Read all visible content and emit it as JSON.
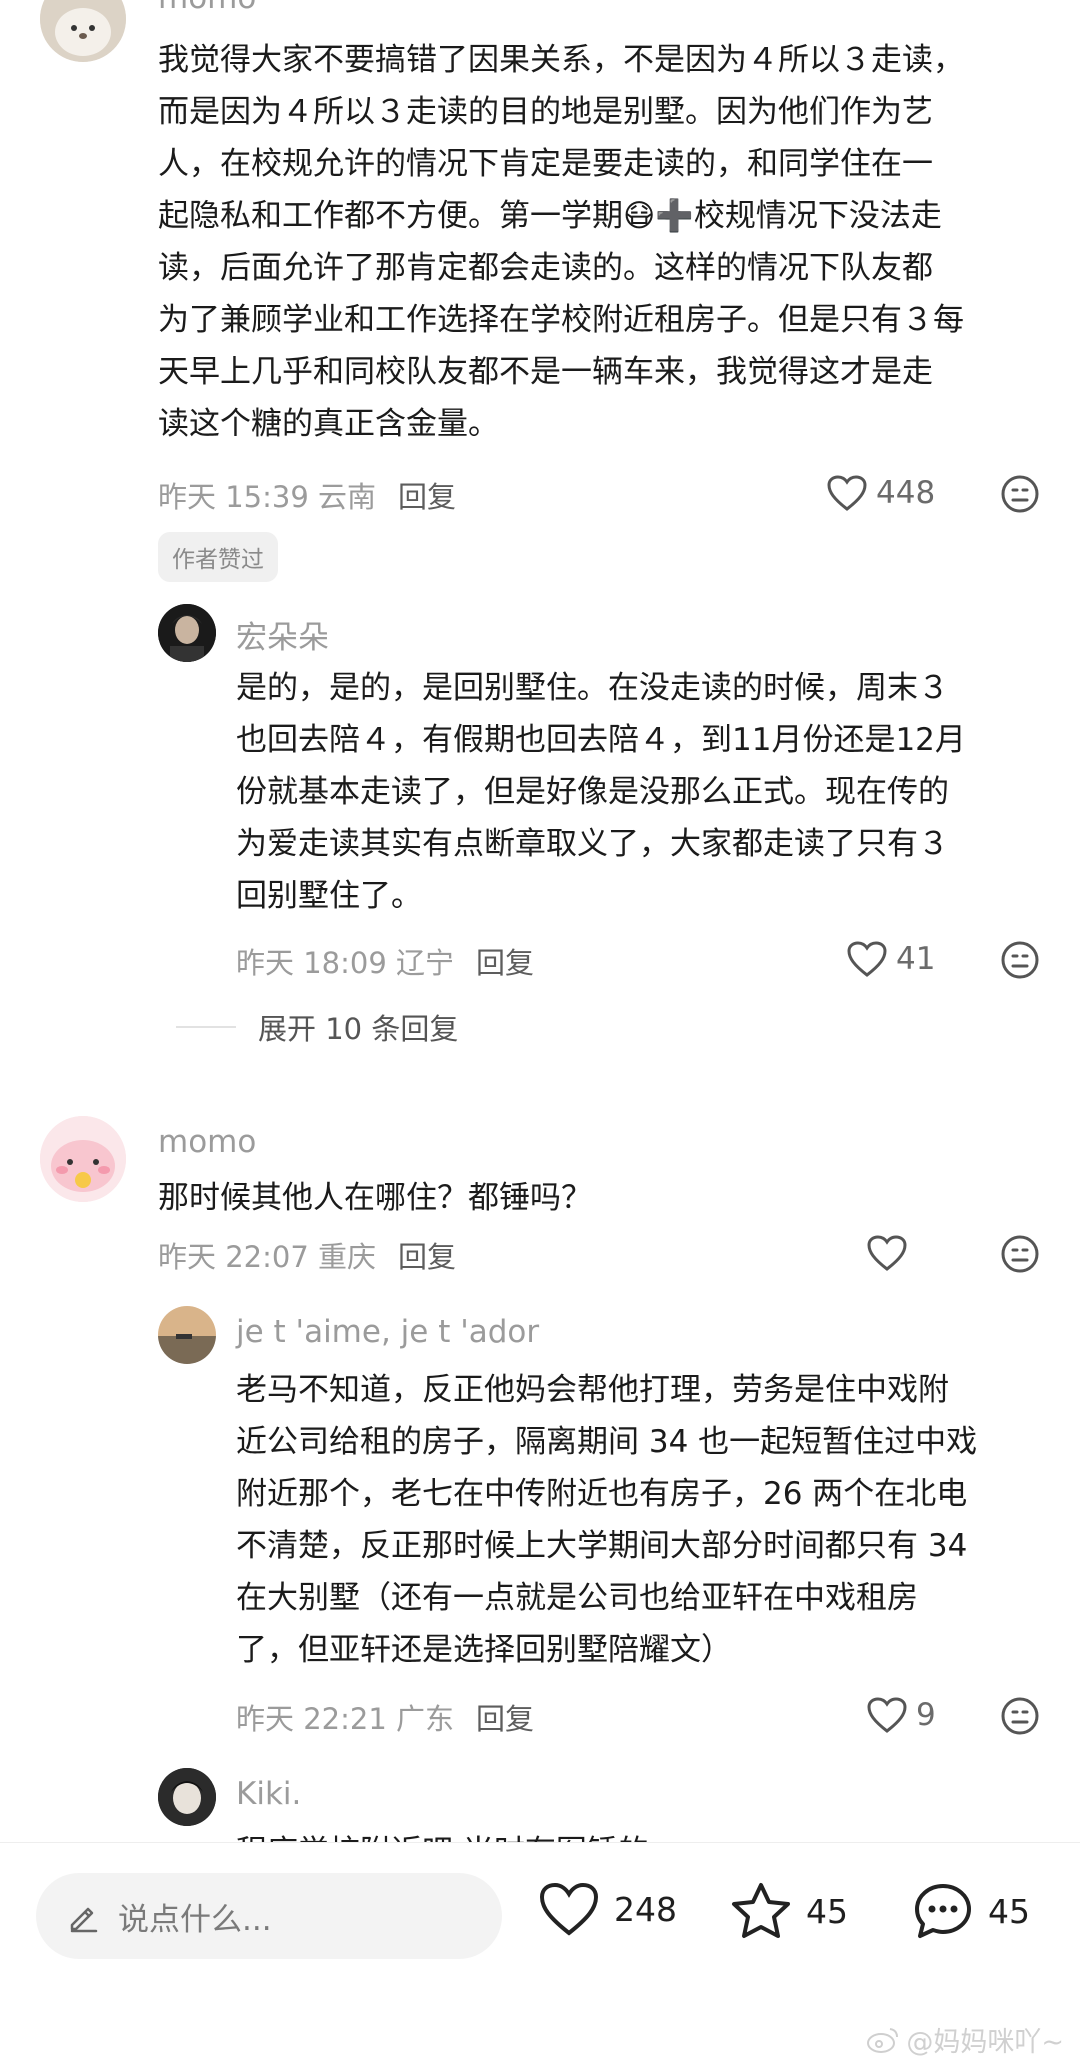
{
  "comments": [
    {
      "username": "momo",
      "text": "我觉得大家不要搞错了因果关系，不是因为４所以３走读，\n而是因为４所以３走读的目的地是别墅。因为他们作为艺\n人，在校规允许的情况下肯定是要走读的，和同学住在一\n起隐私和工作都不方便。第一学期😷➕校规情况下没法走\n读，后面允许了那肯定都会走读的。这样的情况下队友都\n为了兼顾学业和工作选择在学校附近租房子。但是只有３每\n天早上几乎和同校队友都不是一辆车来，我觉得这才是走\n读这个糖的真正含金量。",
      "time": "昨天 15:39 云南",
      "reply_label": "回复",
      "likes": "448",
      "author_liked": "作者赞过"
    },
    {
      "username": "宏朵朵",
      "text": "是的，是的，是回别墅住。在没走读的时候，周末３\n也回去陪４，有假期也回去陪４，到11月份还是12月\n份就基本走读了，但是好像是没那么正式。现在传的\n为爱走读其实有点断章取义了，大家都走读了只有３\n回别墅住了。",
      "time": "昨天 18:09 辽宁",
      "reply_label": "回复",
      "likes": "41",
      "expand_label": "展开 10 条回复"
    },
    {
      "username": "momo",
      "text": "那时候其他人在哪住？都锤吗？",
      "time": "昨天 22:07 重庆",
      "reply_label": "回复",
      "likes": ""
    },
    {
      "username": "je t 'aime, je t 'ador",
      "text": "老马不知道，反正他妈会帮他打理，劳务是住中戏附\n近公司给租的房子，隔离期间 34 也一起短暂住过中戏\n附近那个，老七在中传附近也有房子，26 两个在北电\n不清楚，反正那时候上大学期间大部分时间都只有 34\n在大别墅（还有一点就是公司也给亚轩在中戏租房\n了，但亚轩还是选择回别墅陪耀文）",
      "time": "昨天 22:21 广东",
      "reply_label": "回复",
      "likes": "9"
    },
    {
      "username": "Kiki.",
      "text": "程序学校附近吧 当时有图锤的",
      "time": "",
      "reply_label": "",
      "likes": ""
    }
  ],
  "bottom_bar": {
    "input_placeholder": "说点什么...",
    "likes": "248",
    "favorites": "45",
    "comments": "45"
  },
  "watermark": "@妈妈咪吖~",
  "colors": {
    "text": "#1b1b1b",
    "meta": "#9b9b9b",
    "tag_bg": "#f0f0f0"
  }
}
